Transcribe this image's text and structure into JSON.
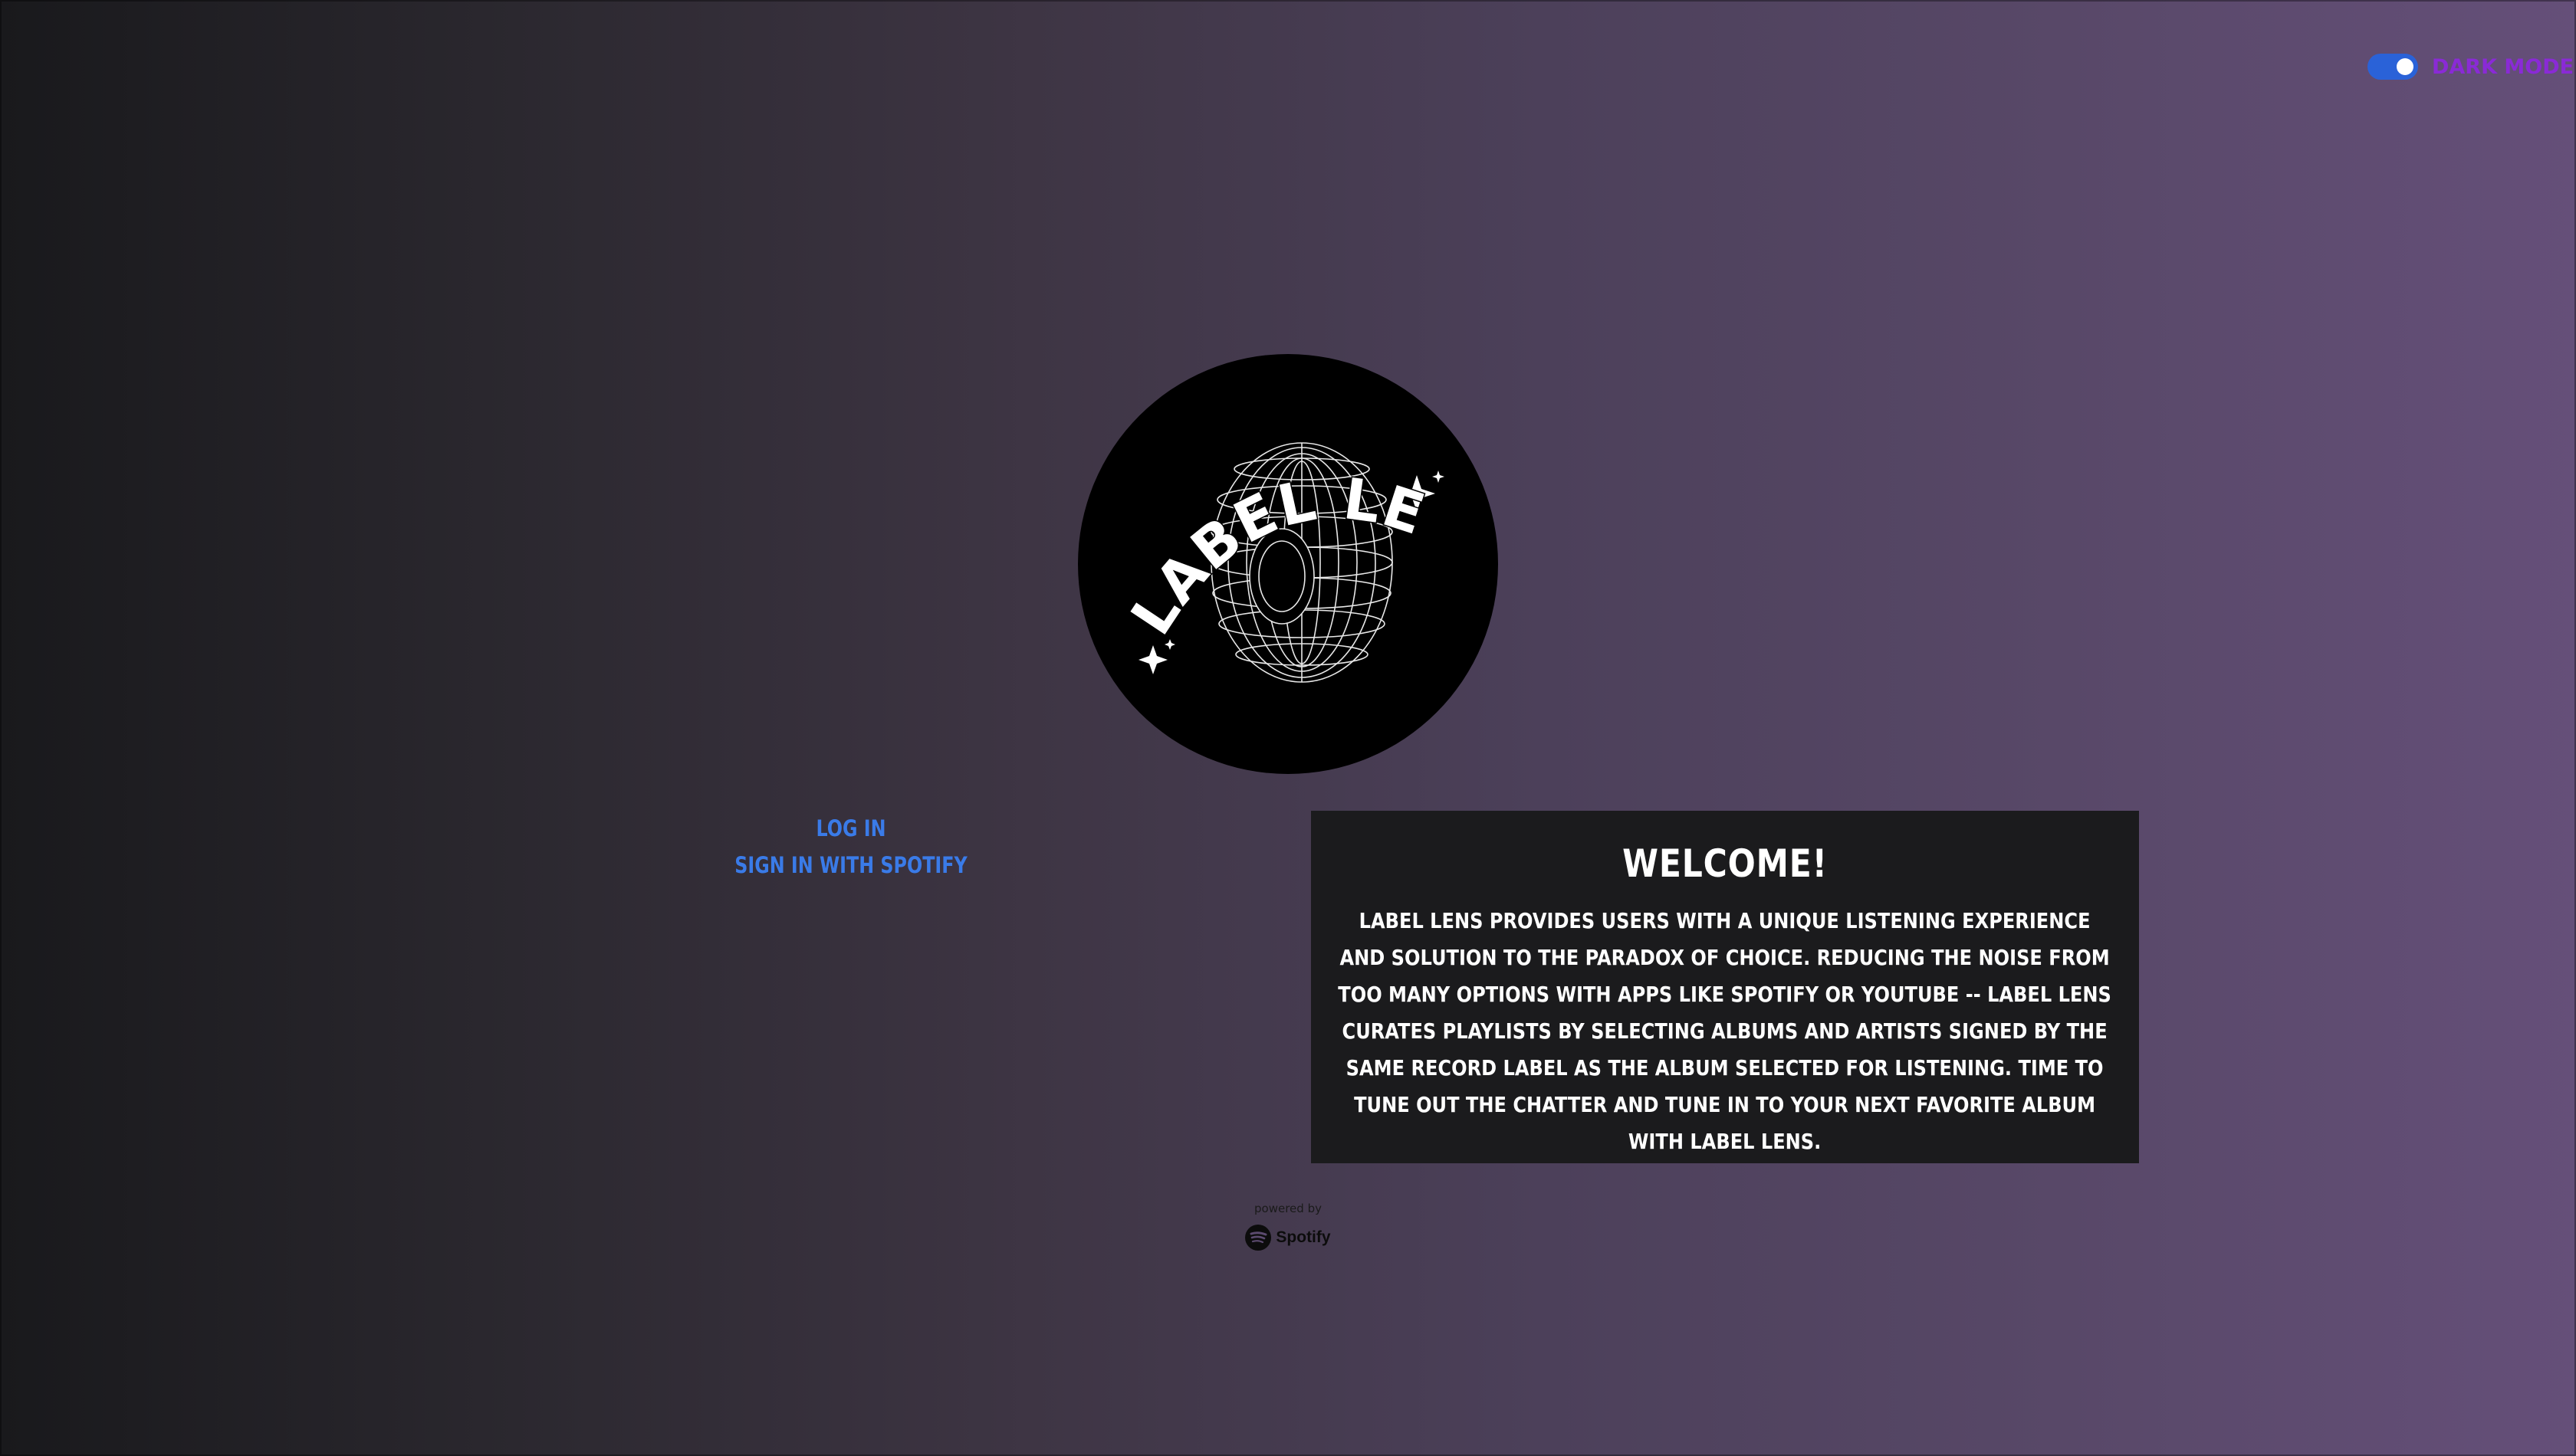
{
  "toggle": {
    "label": "Dark Mode",
    "state": "on",
    "track_color": "#2a62d8",
    "label_color": "#8a2ad6"
  },
  "logo": {
    "text": "LABEL LENS",
    "icon": "wireframe-globe-icon"
  },
  "auth": {
    "login_label": "Log In",
    "spotify_label": "Sign in with Spotify",
    "link_color": "#3a7be8"
  },
  "welcome": {
    "title": "Welcome!",
    "body": "Label Lens provides users with a unique listening experience and solution to the paradox of choice. Reducing the noise from too many options with apps like Spotify or YouTube -- Label Lens curates playlists by selecting albums and artists signed by the same record label as the album selected for listening. Time to tune out the chatter and tune in to your next favorite album with Label Lens."
  },
  "footer": {
    "powered_by": "powered by",
    "brand": "Spotify",
    "brand_icon": "spotify-icon"
  }
}
